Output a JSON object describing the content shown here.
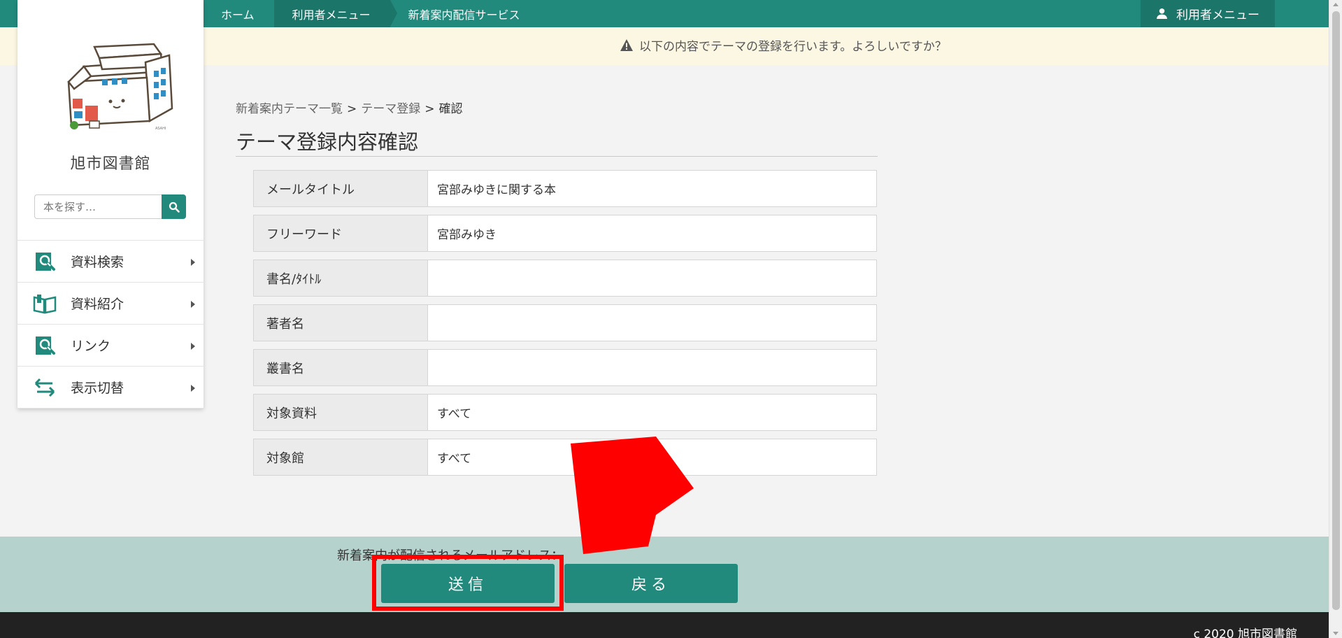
{
  "header": {
    "breadcrumbs": [
      {
        "label": "ホーム"
      },
      {
        "label": "利用者メニュー"
      },
      {
        "label": "新着案内配信サービス"
      }
    ],
    "user_menu_label": "利用者メニュー",
    "user_icon": "person-icon"
  },
  "notice": {
    "icon": "warning-icon",
    "message": "以下の内容でテーマの登録を行います。よろしいですか？"
  },
  "sidebar": {
    "library_name": "旭市図書館",
    "search": {
      "placeholder": "本を探す…",
      "icon": "search-icon"
    },
    "items": [
      {
        "label": "資料検索",
        "icon": "magnifier-book-icon"
      },
      {
        "label": "資料紹介",
        "icon": "open-book-icon"
      },
      {
        "label": "リンク",
        "icon": "magnifier-book-icon"
      },
      {
        "label": "表示切替",
        "icon": "switch-arrows-icon"
      }
    ]
  },
  "main": {
    "breadcrumb": {
      "list": "新着案内テーマ一覧",
      "register": "テーマ登録",
      "current": "確認",
      "separator": ">"
    },
    "title": "テーマ登録内容確認",
    "fields": [
      {
        "label": "メールタイトル",
        "value": "宮部みゆきに関する本"
      },
      {
        "label": "フリーワード",
        "value": "宮部みゆき"
      },
      {
        "label": "書名/ﾀｲﾄﾙ",
        "value": ""
      },
      {
        "label": "著者名",
        "value": ""
      },
      {
        "label": "叢書名",
        "value": ""
      },
      {
        "label": "対象資料",
        "value": "すべて"
      },
      {
        "label": "対象館",
        "value": "すべて"
      }
    ]
  },
  "actions": {
    "mail_address_label": "新着案内が配信されるメールアドレス：",
    "send_label": "送信",
    "back_label": "戻る"
  },
  "footer": {
    "copyright": "c 2020 旭市図書館"
  },
  "colors": {
    "primary": "#218a7c",
    "primary_dark": "#1c7569",
    "notice_bg": "#fcf7e3",
    "action_band": "#b6d2cd",
    "annotation": "#ff0000"
  }
}
